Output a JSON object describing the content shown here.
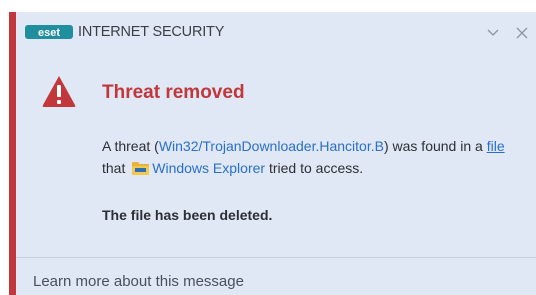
{
  "header": {
    "logo_text": "eset",
    "title": "INTERNET SECURITY",
    "collapse_icon": "chevron-down-icon",
    "close_icon": "close-icon"
  },
  "alert": {
    "icon": "warning-triangle-icon",
    "title": "Threat removed",
    "msg_prefix": "A threat (",
    "threat_name": "Win32/TrojanDownloader.Hancitor.B",
    "msg_mid1": ") was found in a ",
    "file_link": "file",
    "msg_mid2": " that ",
    "app_icon": "windows-explorer-folder-icon",
    "app_name": "Windows Explorer",
    "msg_suffix": " tried to access.",
    "status": "The file has been deleted."
  },
  "footer": {
    "link": "Learn more about this message"
  },
  "colors": {
    "accent_red": "#c2373b",
    "background": "#dfe8f4",
    "link_blue": "#2a6fc9"
  }
}
